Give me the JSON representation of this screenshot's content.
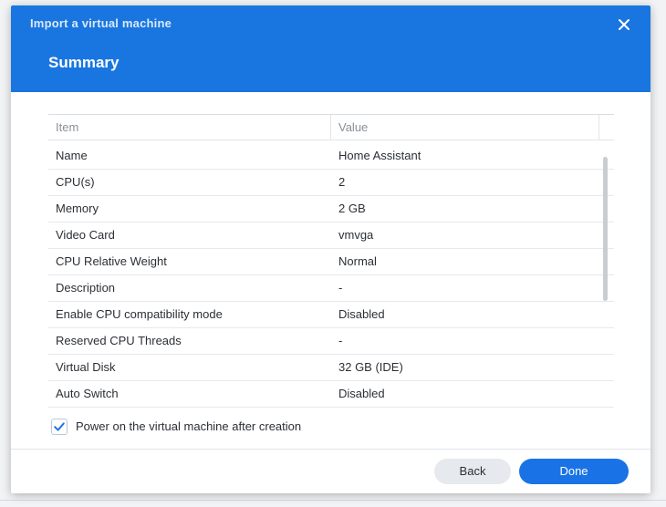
{
  "dialog": {
    "window_title": "Import a virtual machine",
    "step_title": "Summary"
  },
  "grid": {
    "columns": [
      "Item",
      "Value"
    ],
    "rows": [
      {
        "item": "Name",
        "value": "Home Assistant"
      },
      {
        "item": "CPU(s)",
        "value": "2"
      },
      {
        "item": "Memory",
        "value": "2 GB"
      },
      {
        "item": "Video Card",
        "value": "vmvga"
      },
      {
        "item": "CPU Relative Weight",
        "value": "Normal"
      },
      {
        "item": "Description",
        "value": "-"
      },
      {
        "item": "Enable CPU compatibility mode",
        "value": "Disabled"
      },
      {
        "item": "Reserved CPU Threads",
        "value": "-"
      },
      {
        "item": "Virtual Disk",
        "value": "32 GB (IDE)"
      },
      {
        "item": "Auto Switch",
        "value": "Disabled"
      }
    ]
  },
  "options": {
    "power_on_label": "Power on the virtual machine after creation",
    "power_on_checked": true
  },
  "footer": {
    "back_label": "Back",
    "done_label": "Done"
  },
  "colors": {
    "header": "#1976e0",
    "primary_button": "#1a73e6",
    "checkbox_check": "#1a73e6"
  },
  "icons": {
    "close": "close-icon",
    "checkbox": "checkmark-icon"
  }
}
